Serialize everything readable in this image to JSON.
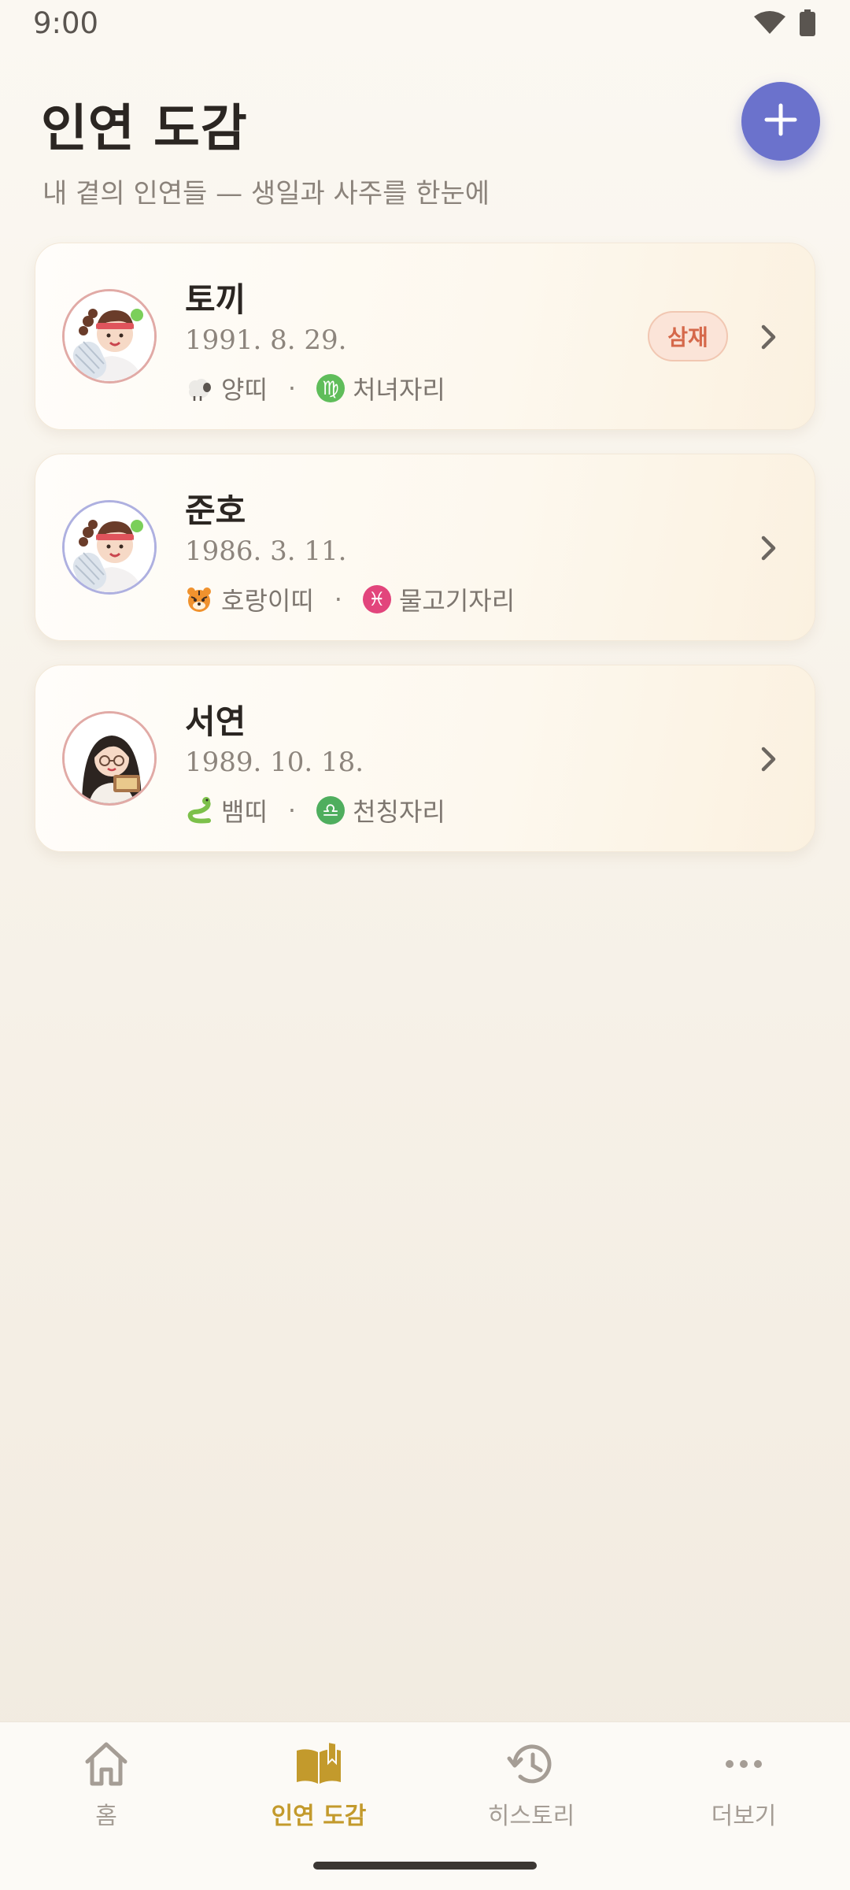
{
  "status_bar": {
    "time": "9:00"
  },
  "header": {
    "title": "인연 도감",
    "subtitle": "내 곁의 인연들 — 생일과 사주를 한눈에"
  },
  "contacts": [
    {
      "name": "토끼",
      "birth": "1991. 8. 29.",
      "animal_icon": "sheep-icon",
      "animal": "양띠",
      "zodiac_icon": "virgo-icon",
      "zodiac_symbol": "♍",
      "zodiac": "처녀자리",
      "badge": "삼재"
    },
    {
      "name": "준호",
      "birth": "1986. 3. 11.",
      "animal_icon": "tiger-icon",
      "animal": "호랑이띠",
      "zodiac_icon": "pisces-icon",
      "zodiac_symbol": "♓",
      "zodiac": "물고기자리"
    },
    {
      "name": "서연",
      "birth": "1989. 10. 18.",
      "animal_icon": "snake-icon",
      "animal": "뱀띠",
      "zodiac_icon": "libra-icon",
      "zodiac_symbol": "♎",
      "zodiac": "천칭자리"
    }
  ],
  "separator": "·",
  "nav": {
    "items": [
      {
        "label": "홈",
        "icon": "home-icon"
      },
      {
        "label": "인연 도감",
        "icon": "book-icon"
      },
      {
        "label": "히스토리",
        "icon": "history-icon"
      },
      {
        "label": "더보기",
        "icon": "more-icon"
      }
    ]
  },
  "colors": {
    "accent": "#6b72cc",
    "active_nav": "#c39a2c",
    "badge_text": "#d5684a",
    "badge_bg": "#fbe4d8"
  }
}
